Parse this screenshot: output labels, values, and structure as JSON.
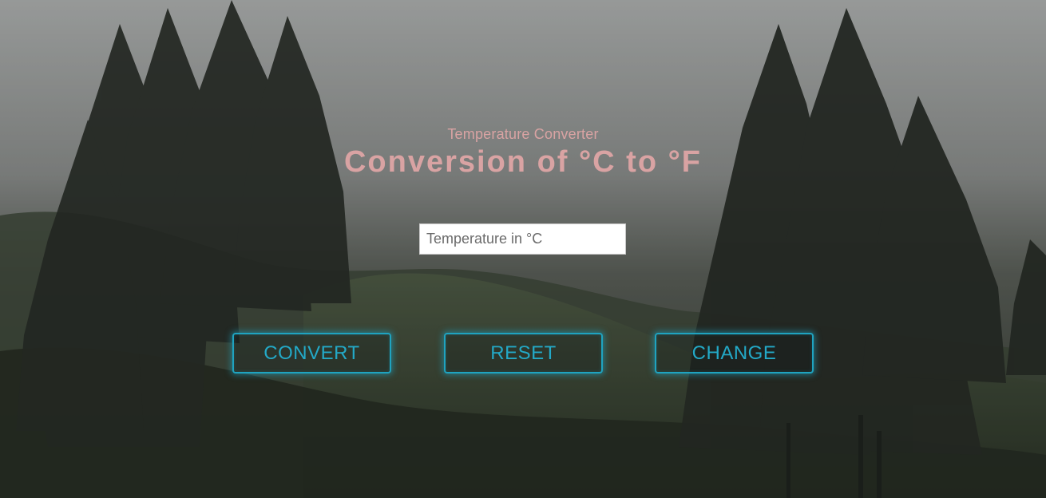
{
  "header": {
    "subtitle": "Temperature Converter",
    "title": "Conversion of °C to °F"
  },
  "input": {
    "placeholder": "Temperature in °C",
    "value": ""
  },
  "buttons": {
    "convert": "CONVERT",
    "reset": "RESET",
    "change": "CHANGE"
  },
  "colors": {
    "title_text": "#d9a3a3",
    "button_accent": "#1fa3c0"
  }
}
